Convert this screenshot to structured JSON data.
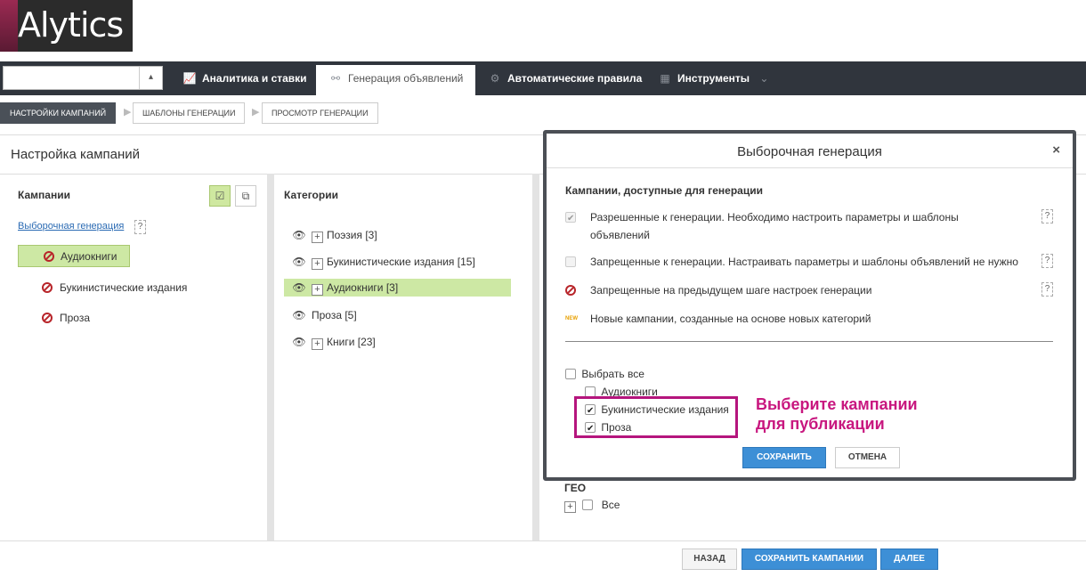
{
  "logo": {
    "text": "Alytics"
  },
  "nav": {
    "select_value": "",
    "tabs": [
      {
        "label": "Аналитика и ставки",
        "icon": "chart-line-icon"
      },
      {
        "label": "Генерация объявлений",
        "icon": "hierarchy-icon",
        "active": true
      },
      {
        "label": "Автоматические правила",
        "icon": "gear-icon"
      },
      {
        "label": "Инструменты",
        "icon": "grid-icon"
      }
    ]
  },
  "steps": [
    "НАСТРОЙКИ КАМПАНИЙ",
    "ШАБЛОНЫ ГЕНЕРАЦИИ",
    "ПРОСМОТР ГЕНЕРАЦИИ"
  ],
  "page_title": "Настройка кампаний",
  "campaigns": {
    "title": "Кампании",
    "selective_link": "Выборочная генерация",
    "help": "?",
    "items": [
      "Аудиокниги",
      "Букинистические издания",
      "Проза"
    ]
  },
  "categories": {
    "title": "Категории",
    "items": [
      "Поэзия [3]",
      "Букинистические издания [15]",
      "Аудиокниги [3]",
      "Проза [5]",
      "Книги [23]"
    ]
  },
  "geo": {
    "title": "ГЕО",
    "all_label": "Все"
  },
  "modal": {
    "title": "Выборочная генерация",
    "close": "×",
    "section_title": "Кампании, доступные для генерации",
    "legend": [
      "Разрешенные к генерации. Необходимо настроить параметры и шаблоны",
      "объявлений",
      "Запрещенные к генерации. Настраивать параметры и шаблоны объявлений не нужно",
      "Запрещенные на предыдущем шаге настроек генерации",
      "Новые кампании, созданные на основе новых категорий"
    ],
    "new_badge": "NEW",
    "select_all": "Выбрать все",
    "options": [
      {
        "label": "Аудиокниги",
        "checked": false
      },
      {
        "label": "Букинистические издания",
        "checked": true
      },
      {
        "label": "Проза",
        "checked": true
      }
    ],
    "save": "СОХРАНИТЬ",
    "cancel": "ОТМЕНА"
  },
  "callout": [
    "Выберите кампании",
    "для публикации"
  ],
  "footer": {
    "back": "НАЗАД",
    "save_campaigns": "СОХРАНИТЬ КАМПАНИИ",
    "next": "ДАЛЕЕ"
  },
  "colors": {
    "accent": "#3d8fd6",
    "highlight": "#b5157d",
    "selected_bg": "#cde8a4",
    "nav_bg": "#30353d"
  }
}
